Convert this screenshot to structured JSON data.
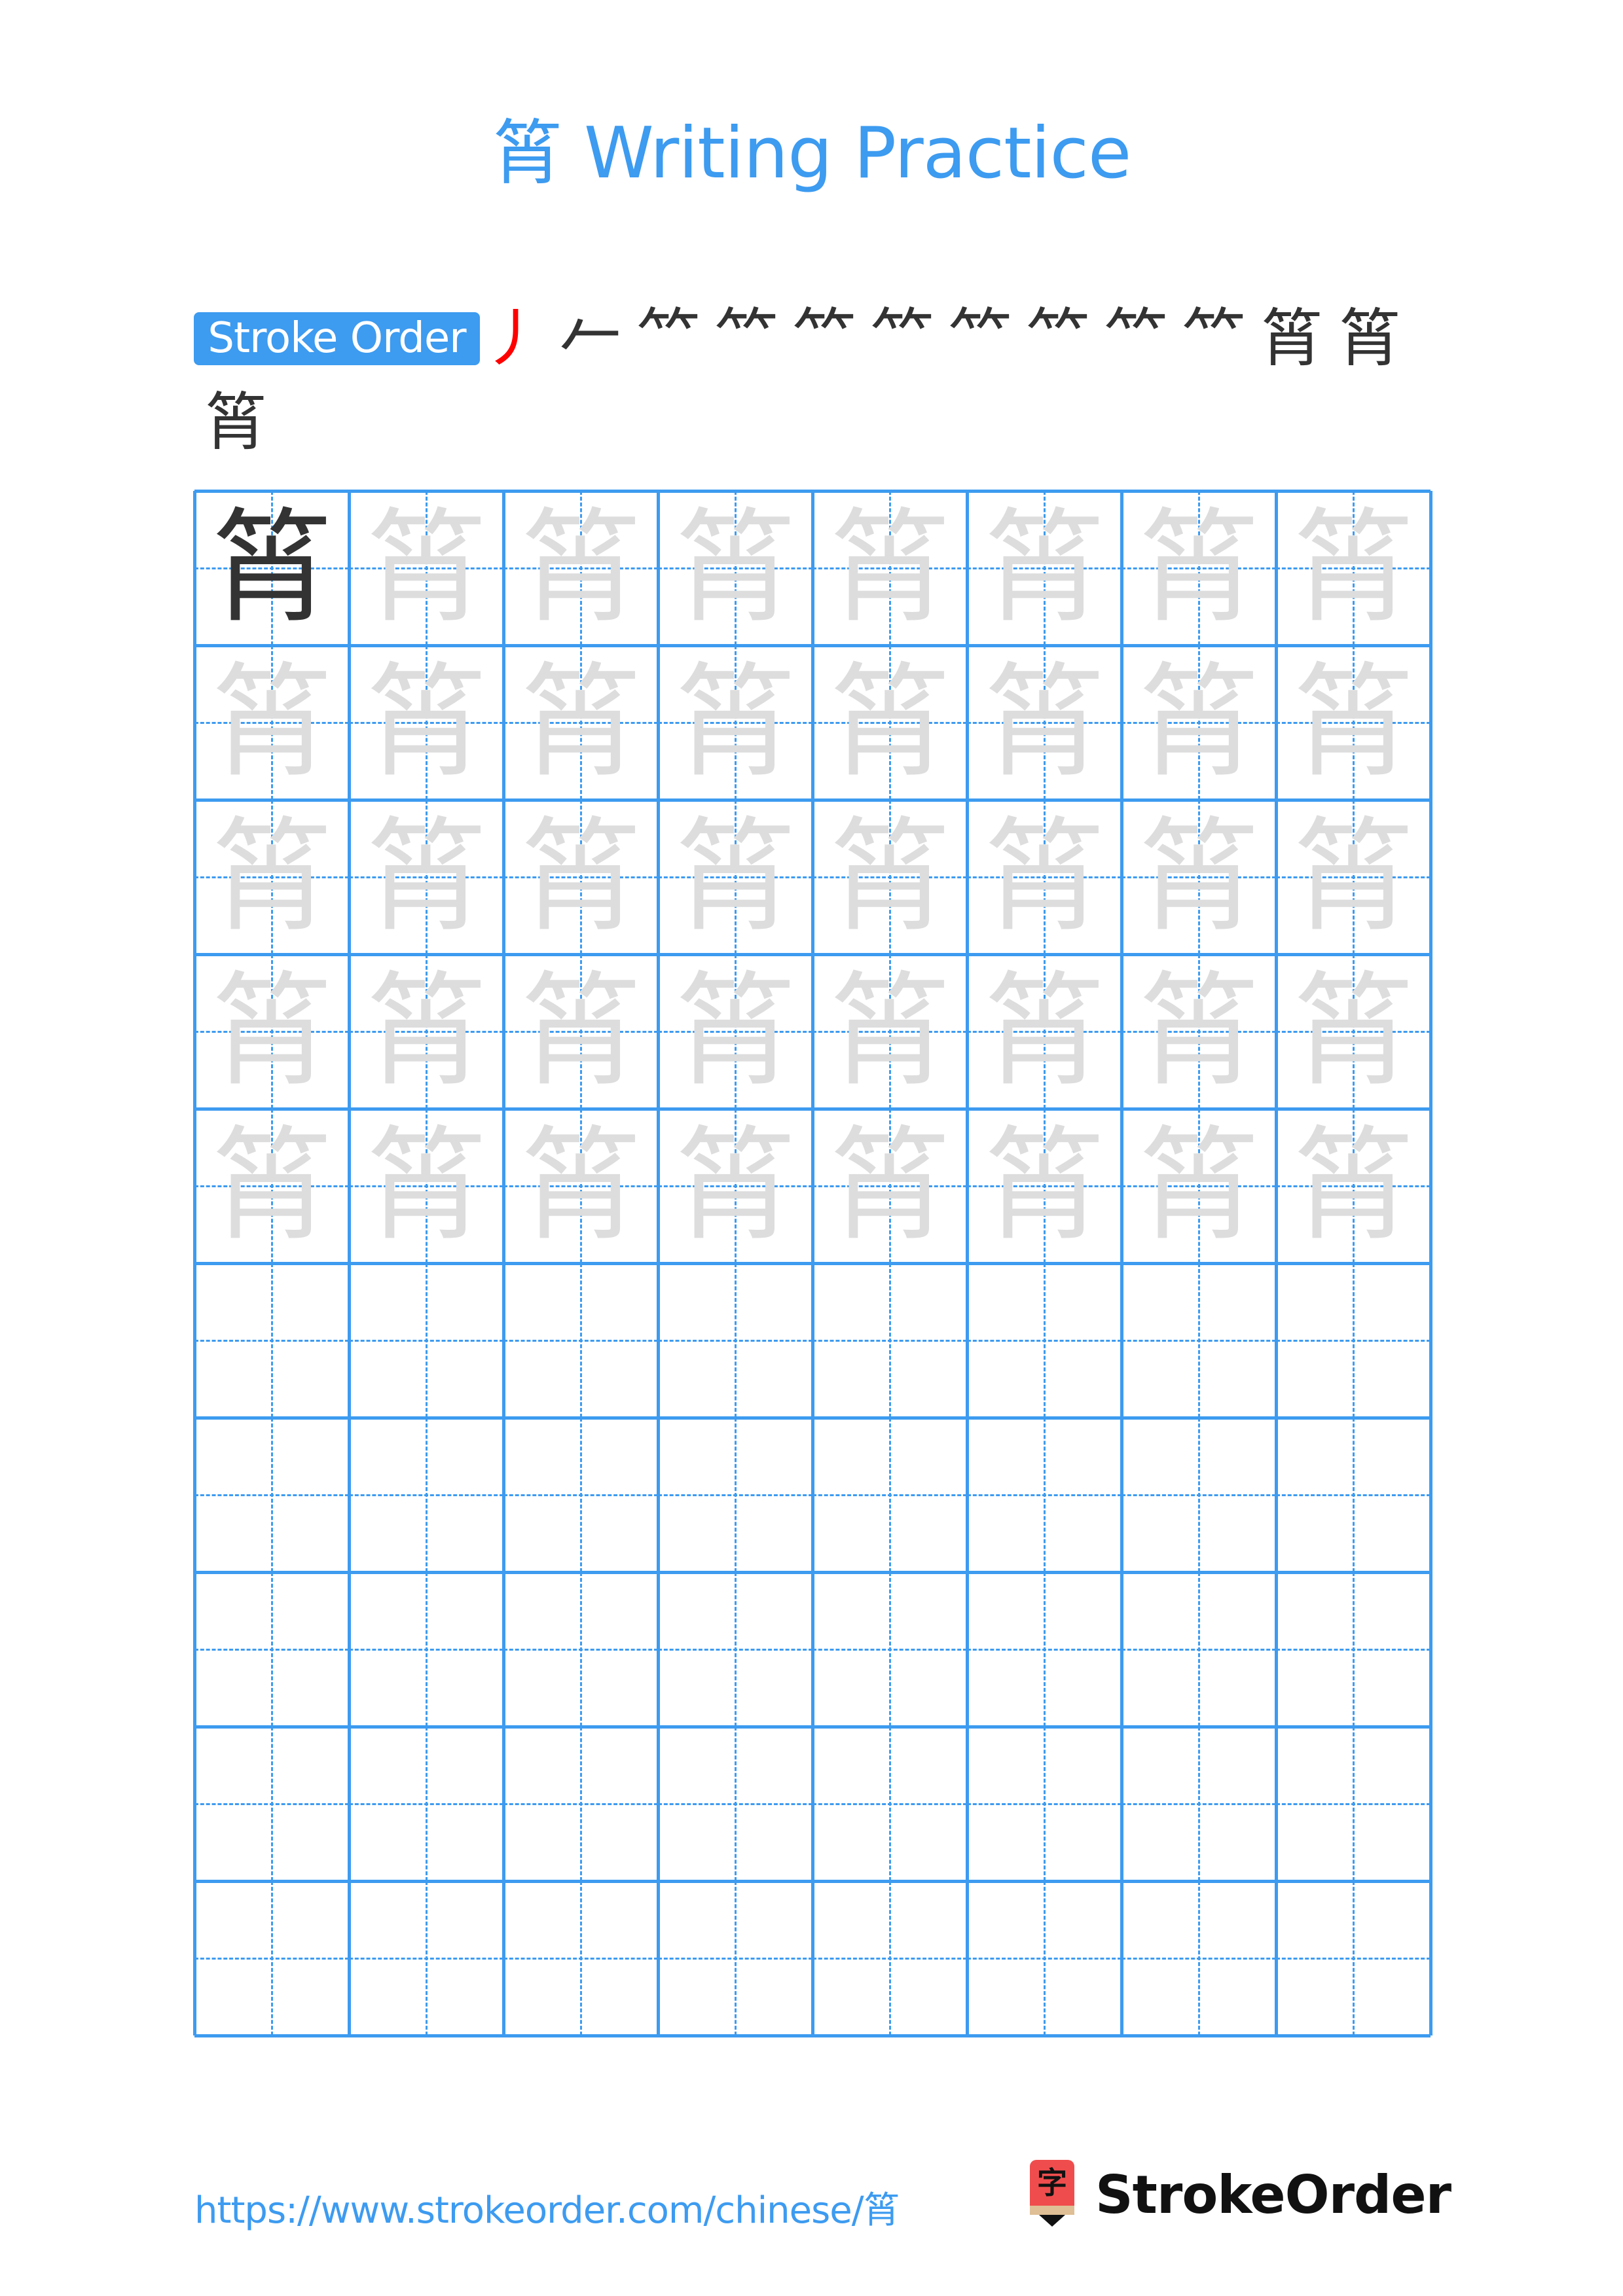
{
  "page": {
    "character": "筲",
    "title": "筲 Writing Practice"
  },
  "stroke_order": {
    "label": "Stroke Order",
    "total_strokes": 13,
    "steps": [
      {
        "step": 1,
        "glyph": "丿",
        "new_stroke_color": "#ff0000"
      },
      {
        "step": 2,
        "glyph": "𠂉",
        "new_stroke_color": "#ff0000"
      },
      {
        "step": 3,
        "glyph": "𥫗",
        "new_stroke_color": "#ff0000"
      },
      {
        "step": 4,
        "glyph": "𥫗",
        "new_stroke_color": "#ff0000"
      },
      {
        "step": 5,
        "glyph": "𥫗",
        "new_stroke_color": "#ff0000"
      },
      {
        "step": 6,
        "glyph": "⺮",
        "new_stroke_color": "#ff0000"
      },
      {
        "step": 7,
        "glyph": "⺮",
        "new_stroke_color": "#ff0000"
      },
      {
        "step": 8,
        "glyph": "⺮",
        "new_stroke_color": "#ff0000"
      },
      {
        "step": 9,
        "glyph": "⺮",
        "new_stroke_color": "#ff0000"
      },
      {
        "step": 10,
        "glyph": "⺮",
        "new_stroke_color": "#ff0000"
      },
      {
        "step": 11,
        "glyph": "筲",
        "new_stroke_color": "#ff0000"
      },
      {
        "step": 12,
        "glyph": "筲",
        "new_stroke_color": "#ff0000"
      },
      {
        "step": 13,
        "glyph": "筲",
        "new_stroke_color": "#ff0000"
      }
    ]
  },
  "practice_grid": {
    "rows": 10,
    "columns": 8,
    "model_character": "筲",
    "ghost_character": "筲",
    "model_cells": 1,
    "ghost_rows": 5,
    "empty_rows": 5,
    "line_color": "#3d9bf0",
    "model_color": "#333333",
    "ghost_color": "#dddddd"
  },
  "footer": {
    "url": "https://www.strokeorder.com/chinese/筲",
    "logo_glyph": "字",
    "brand": "StrokeOrder"
  },
  "colors": {
    "accent": "#3d9bf0",
    "highlight": "#ff0000",
    "logo_red": "#ef4d4d"
  }
}
